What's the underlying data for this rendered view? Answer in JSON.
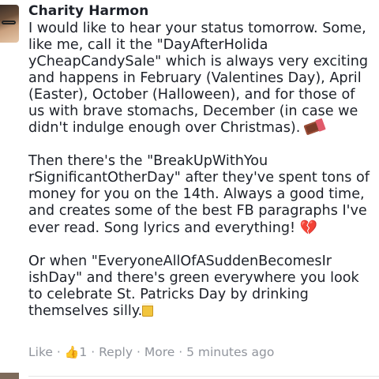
{
  "comment": {
    "author": "Charity Harmon",
    "paragraphs": [
      "I would like to hear your status tomorrow. Some, like me, call it the \"DayAfterHolida yCheapCandySale\" which is always very exciting and happens in February (Valentines Day), April (Easter), October (Halloween), and for those of us with brave stomachs, December (in case we didn't indulge enough over Christmas).",
      "Then there's the \"BreakUpWithYou rSignificantOtherDay\" after they've spent tons of money for you on the 14th. Always a good time, and creates some of the best FB paragraphs I've ever read. Song lyrics and everything!",
      "Or when \"EveryoneAllOfASuddenBecomesIr ishDay\" and there's green everywhere you look to celebrate St. Patricks Day by drinking themselves silly."
    ],
    "emojis": [
      "chocolate-bar-icon",
      "broken-heart-icon",
      "beer-mugs-icon"
    ],
    "actions": {
      "like_label": "Like",
      "like_count": "1",
      "reply_label": "Reply",
      "more_label": "More",
      "timestamp": "5 minutes ago",
      "separator": "·"
    }
  },
  "colors": {
    "text": "#1d2129",
    "meta": "#90949c",
    "like_icon": "#5890ff"
  }
}
